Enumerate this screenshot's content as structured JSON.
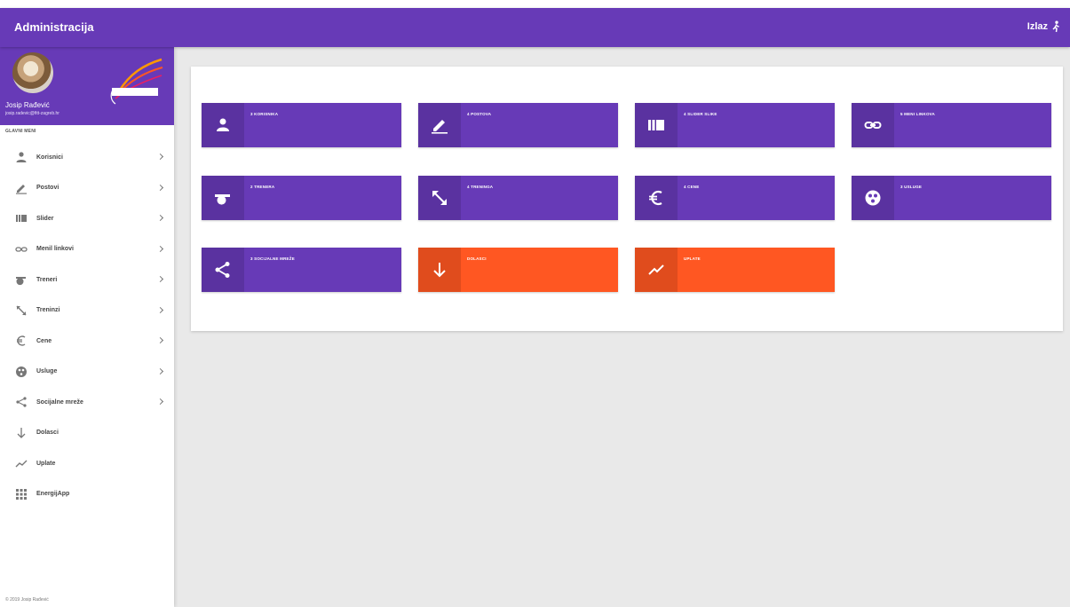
{
  "header": {
    "title": "Administracija",
    "logout_label": "Izlaz"
  },
  "sidebar": {
    "user_name": "Josip Rađević",
    "user_email": "josip.radevic@fitt-zagreb.hr",
    "menu_header": "GLAVNI MENI",
    "items": [
      {
        "label": "Korisnici",
        "icon": "person-icon",
        "has_submenu": true
      },
      {
        "label": "Postovi",
        "icon": "pencil-icon",
        "has_submenu": true
      },
      {
        "label": "Slider",
        "icon": "slider-icon",
        "has_submenu": true
      },
      {
        "label": "Menil linkovi",
        "icon": "link-icon",
        "has_submenu": true
      },
      {
        "label": "Treneri",
        "icon": "whistle-icon",
        "has_submenu": true
      },
      {
        "label": "Treninzi",
        "icon": "resize-icon",
        "has_submenu": true
      },
      {
        "label": "Cene",
        "icon": "euro-icon",
        "has_submenu": true
      },
      {
        "label": "Usluge",
        "icon": "service-icon",
        "has_submenu": true
      },
      {
        "label": "Socijalne mreže",
        "icon": "share-icon",
        "has_submenu": true
      },
      {
        "label": "Dolasci",
        "icon": "arrow-down-icon",
        "has_submenu": false
      },
      {
        "label": "Uplate",
        "icon": "trend-icon",
        "has_submenu": false
      },
      {
        "label": "EnergijApp",
        "icon": "grid-icon",
        "has_submenu": false
      }
    ],
    "footer": "© 2019 Josip Rađević"
  },
  "dashboard": {
    "tiles": [
      {
        "label": "3 KORISNIKA",
        "icon": "person-icon",
        "color": "#673ab7"
      },
      {
        "label": "4 POSTOVA",
        "icon": "pencil-icon",
        "color": "#673ab7"
      },
      {
        "label": "4 SLIDER SLIKE",
        "icon": "slider-icon",
        "color": "#673ab7"
      },
      {
        "label": "5 MENI LINKOVA",
        "icon": "link-icon",
        "color": "#673ab7"
      },
      {
        "label": "2 TRENERA",
        "icon": "whistle-icon",
        "color": "#673ab7"
      },
      {
        "label": "4 TRENINGA",
        "icon": "resize-icon",
        "color": "#673ab7"
      },
      {
        "label": "4 CENE",
        "icon": "euro-icon",
        "color": "#673ab7"
      },
      {
        "label": "3 USLUGE",
        "icon": "service-icon",
        "color": "#673ab7"
      },
      {
        "label": "3 SOCIJALNE MREŽE",
        "icon": "share-icon",
        "color": "#673ab7"
      },
      {
        "label": "DOLASCI",
        "icon": "arrow-down-icon",
        "color": "#ff5722"
      },
      {
        "label": "UPLATE",
        "icon": "trend-icon",
        "color": "#ff5722"
      }
    ]
  },
  "colors": {
    "primary": "#673ab7",
    "accent": "#ff5722",
    "content_bg": "#e9e9e9"
  }
}
